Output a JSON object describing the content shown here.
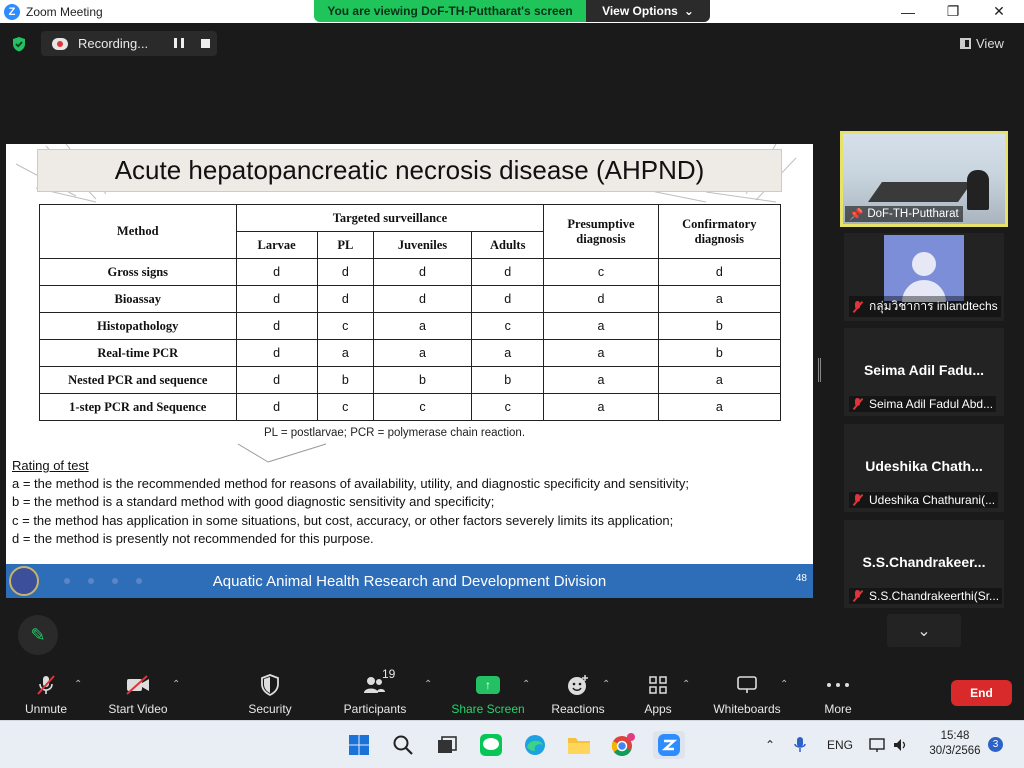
{
  "window": {
    "title": "Zoom Meeting",
    "logo_letter": "Z",
    "minimize_glyph": "—",
    "maximize_glyph": "❐",
    "close_glyph": "✕"
  },
  "share_banner": {
    "message": "You are viewing DoF-TH-Puttharat's screen",
    "options_label": "View Options"
  },
  "topbar": {
    "recording_label": "Recording...",
    "view_label": "View"
  },
  "slide": {
    "title": "Acute hepatopancreatic necrosis disease (AHPND)",
    "table": {
      "method_header": "Method",
      "targeted_header": "Targeted surveillance",
      "stage_headers": [
        "Larvae",
        "PL",
        "Juveniles",
        "Adults"
      ],
      "presumptive_header": "Presumptive diagnosis",
      "confirmatory_header": "Confirmatory diagnosis",
      "rows": [
        {
          "method": "Gross signs",
          "values": [
            "d",
            "d",
            "d",
            "d",
            "c",
            "d"
          ]
        },
        {
          "method": "Bioassay",
          "values": [
            "d",
            "d",
            "d",
            "d",
            "d",
            "a"
          ]
        },
        {
          "method": "Histopathology",
          "values": [
            "d",
            "c",
            "a",
            "c",
            "a",
            "b"
          ]
        },
        {
          "method": "Real-time PCR",
          "values": [
            "d",
            "a",
            "a",
            "a",
            "a",
            "b"
          ]
        },
        {
          "method": "Nested PCR and sequence",
          "values": [
            "d",
            "b",
            "b",
            "b",
            "a",
            "a"
          ]
        },
        {
          "method": "1-step PCR and Sequence",
          "values": [
            "d",
            "c",
            "c",
            "c",
            "a",
            "a"
          ]
        }
      ]
    },
    "abbreviations": "PL = postlarvae; PCR = polymerase chain reaction.",
    "rating_header": "Rating of test",
    "rating_lines": [
      "a = the method is the recommended method for reasons of availability, utility, and diagnostic specificity and sensitivity;",
      "b = the method is a standard method with good diagnostic sensitivity and specificity;",
      "c = the method has application in some situations, but cost, accuracy, or other factors severely limits its application;",
      "d = the method is presently not recommended for this purpose."
    ],
    "footer_text": "Aquatic Animal Health Research and Development Division",
    "page_number": "48"
  },
  "participants_panel": {
    "main_video_name": "DoF-TH-Puttharat",
    "tiles": [
      {
        "big_name": "",
        "label": "กลุ่มวิชาการ inlandtechs"
      },
      {
        "big_name": "Seima Adil Fadu...",
        "label": "Seima Adil Fadul Abd..."
      },
      {
        "big_name": "Udeshika Chath...",
        "label": "Udeshika Chathurani(..."
      },
      {
        "big_name": "S.S.Chandrakeer...",
        "label": "S.S.Chandrakeerthi(Sr..."
      }
    ]
  },
  "toolbar": {
    "unmute": "Unmute",
    "start_video": "Start Video",
    "security": "Security",
    "participants": "Participants",
    "participants_count": "19",
    "share_screen": "Share Screen",
    "reactions": "Reactions",
    "apps": "Apps",
    "whiteboards": "Whiteboards",
    "more": "More",
    "end": "End"
  },
  "taskbar": {
    "language": "ENG",
    "time": "15:48",
    "date": "30/3/2566",
    "notification_count": "3"
  },
  "colors": {
    "accent_green": "#1fc55a",
    "end_red": "#d82a2a",
    "footer_blue": "#2e6db8",
    "active_speaker": "#e6e26a"
  }
}
